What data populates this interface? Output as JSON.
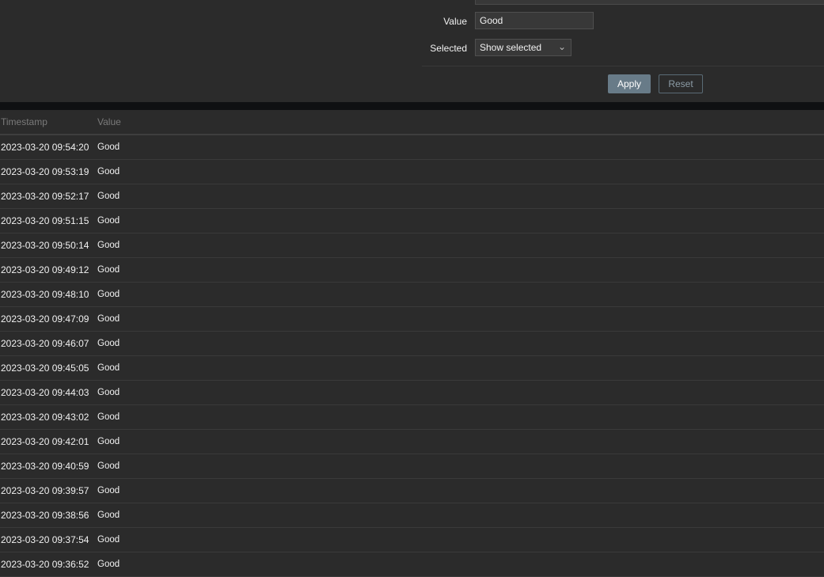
{
  "filter": {
    "value_label": "Value",
    "value_input": "Good",
    "selected_label": "Selected",
    "selected_option": "Show selected",
    "apply": "Apply",
    "reset": "Reset"
  },
  "table": {
    "headers": [
      "Timestamp",
      "Value"
    ],
    "rows": [
      [
        "2023-03-20 09:54:20",
        "Good"
      ],
      [
        "2023-03-20 09:53:19",
        "Good"
      ],
      [
        "2023-03-20 09:52:17",
        "Good"
      ],
      [
        "2023-03-20 09:51:15",
        "Good"
      ],
      [
        "2023-03-20 09:50:14",
        "Good"
      ],
      [
        "2023-03-20 09:49:12",
        "Good"
      ],
      [
        "2023-03-20 09:48:10",
        "Good"
      ],
      [
        "2023-03-20 09:47:09",
        "Good"
      ],
      [
        "2023-03-20 09:46:07",
        "Good"
      ],
      [
        "2023-03-20 09:45:05",
        "Good"
      ],
      [
        "2023-03-20 09:44:03",
        "Good"
      ],
      [
        "2023-03-20 09:43:02",
        "Good"
      ],
      [
        "2023-03-20 09:42:01",
        "Good"
      ],
      [
        "2023-03-20 09:40:59",
        "Good"
      ],
      [
        "2023-03-20 09:39:57",
        "Good"
      ],
      [
        "2023-03-20 09:38:56",
        "Good"
      ],
      [
        "2023-03-20 09:37:54",
        "Good"
      ],
      [
        "2023-03-20 09:36:52",
        "Good"
      ]
    ]
  }
}
